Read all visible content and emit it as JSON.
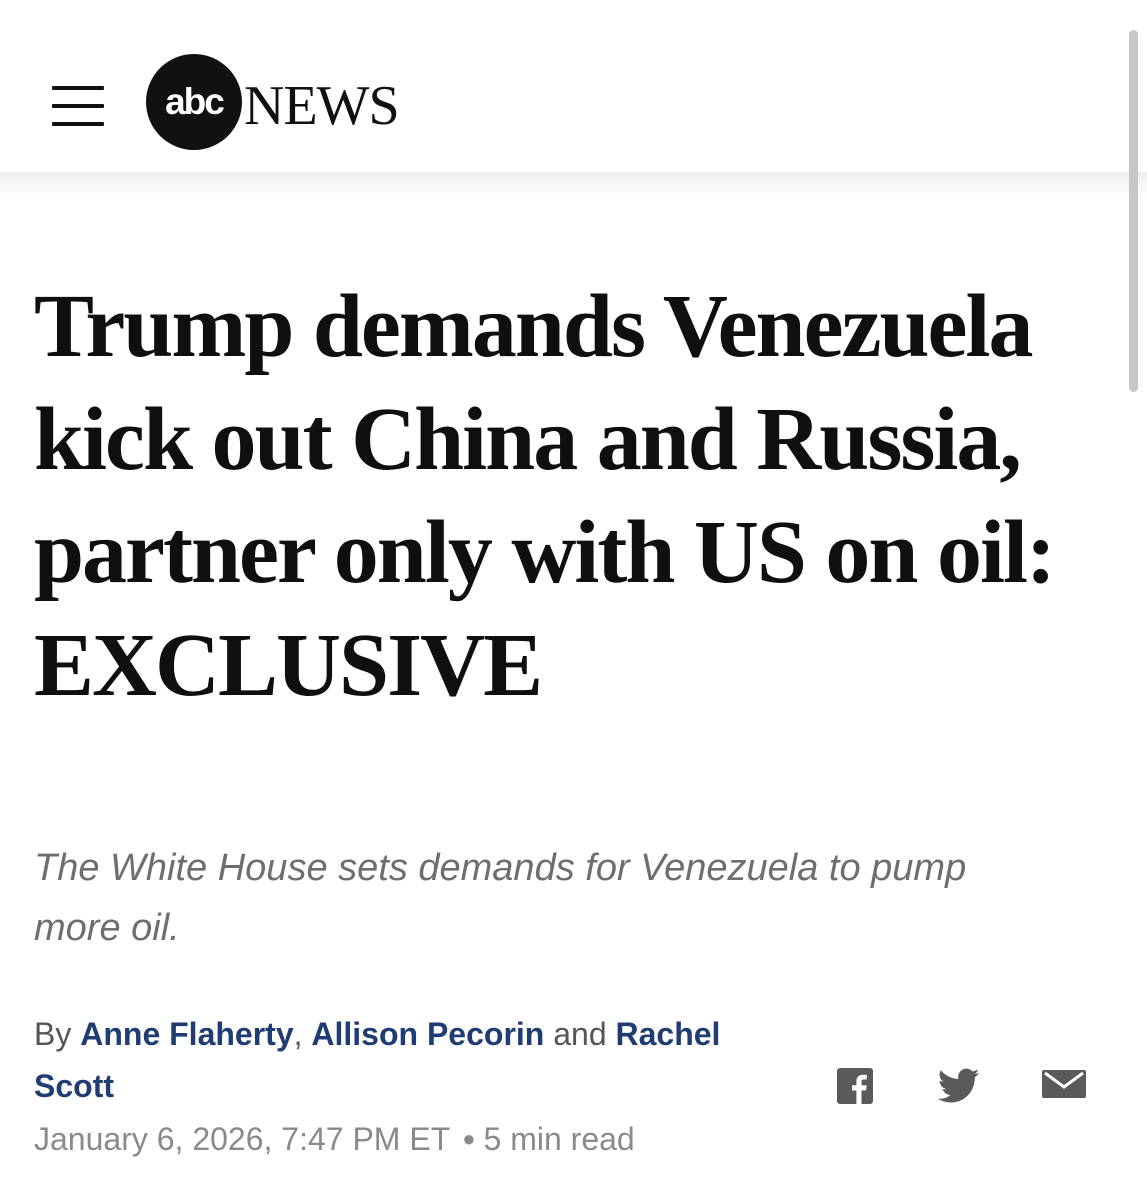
{
  "header": {
    "logo_abc": "abc",
    "logo_news": "NEWS",
    "menu_icon": "hamburger-menu-icon"
  },
  "article": {
    "headline": "Trump demands Venezuela kick out China and Russia, partner only with US on oil: EXCLUSIVE",
    "subheadline": "The White House sets demands for Venezuela to pump more oil.",
    "byline": {
      "prefix": "By",
      "authors": [
        "Anne Flaherty",
        "Allison Pecorin",
        "Rachel Scott"
      ],
      "separator": ",",
      "conjunction": "and"
    },
    "date": "January 6, 2026, 7:47 PM ET",
    "read_time": "5 min read"
  },
  "share": {
    "icons": [
      "facebook-icon",
      "twitter-icon",
      "email-icon"
    ]
  },
  "colors": {
    "author_link": "#1f3d73",
    "subheadline": "#6e6e6e",
    "meta": "#8a8a8a"
  }
}
